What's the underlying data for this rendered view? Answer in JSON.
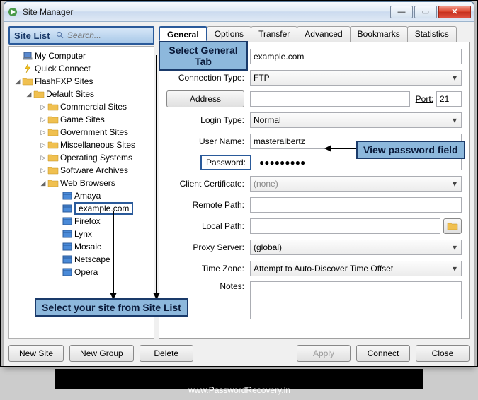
{
  "window": {
    "title": "Site Manager"
  },
  "sidebar": {
    "header_label": "Site List",
    "search_placeholder": "Search..."
  },
  "tree": {
    "nodes": [
      {
        "depth": 0,
        "exp": "",
        "icon": "computer",
        "label": "My Computer"
      },
      {
        "depth": 0,
        "exp": "",
        "icon": "quick",
        "label": "Quick Connect"
      },
      {
        "depth": 0,
        "exp": "◢",
        "icon": "folder",
        "label": "FlashFXP Sites"
      },
      {
        "depth": 1,
        "exp": "◢",
        "icon": "folder",
        "label": "Default Sites"
      },
      {
        "depth": 2,
        "exp": "▷",
        "icon": "folder",
        "label": "Commercial Sites"
      },
      {
        "depth": 2,
        "exp": "▷",
        "icon": "folder",
        "label": "Game Sites"
      },
      {
        "depth": 2,
        "exp": "▷",
        "icon": "folder",
        "label": "Government Sites"
      },
      {
        "depth": 2,
        "exp": "▷",
        "icon": "folder",
        "label": "Miscellaneous Sites"
      },
      {
        "depth": 2,
        "exp": "▷",
        "icon": "folder",
        "label": "Operating Systems"
      },
      {
        "depth": 2,
        "exp": "▷",
        "icon": "folder",
        "label": "Software Archives"
      },
      {
        "depth": 2,
        "exp": "◢",
        "icon": "folder",
        "label": "Web Browsers"
      },
      {
        "depth": 3,
        "exp": "",
        "icon": "site",
        "label": "Amaya"
      },
      {
        "depth": 3,
        "exp": "",
        "icon": "site",
        "label": "example.com",
        "selected": true
      },
      {
        "depth": 3,
        "exp": "",
        "icon": "site",
        "label": "Firefox"
      },
      {
        "depth": 3,
        "exp": "",
        "icon": "site",
        "label": "Lynx"
      },
      {
        "depth": 3,
        "exp": "",
        "icon": "site",
        "label": "Mosaic"
      },
      {
        "depth": 3,
        "exp": "",
        "icon": "site",
        "label": "Netscape"
      },
      {
        "depth": 3,
        "exp": "",
        "icon": "site",
        "label": "Opera"
      }
    ]
  },
  "tabs": {
    "items": [
      {
        "label": "General",
        "active": true
      },
      {
        "label": "Options"
      },
      {
        "label": "Transfer"
      },
      {
        "label": "Advanced"
      },
      {
        "label": "Bookmarks"
      },
      {
        "label": "Statistics"
      }
    ]
  },
  "form": {
    "site_name": "example.com",
    "connection_type_label": "Connection Type:",
    "connection_type_value": "FTP",
    "address_button": "Address",
    "address_value": "",
    "port_label": "Port:",
    "port_value": "21",
    "login_type_label": "Login Type:",
    "login_type_value": "Normal",
    "user_name_label": "User Name:",
    "user_name_value": "masteralbertz",
    "password_label": "Password:",
    "password_value": "●●●●●●●●●",
    "client_cert_label": "Client Certificate:",
    "client_cert_value": "(none)",
    "remote_path_label": "Remote Path:",
    "remote_path_value": "",
    "local_path_label": "Local Path:",
    "local_path_value": "",
    "proxy_label": "Proxy Server:",
    "proxy_value": "(global)",
    "timezone_label": "Time Zone:",
    "timezone_value": "Attempt to Auto-Discover Time Offset",
    "notes_label": "Notes:",
    "notes_value": ""
  },
  "buttons": {
    "new_site": "New Site",
    "new_group": "New Group",
    "delete": "Delete",
    "apply": "Apply",
    "connect": "Connect",
    "close": "Close"
  },
  "annotations": {
    "select_general": "Select General Tab",
    "view_password": "View password field",
    "select_site": "Select your site from Site List"
  },
  "footer": "www.PasswordRecovery.in"
}
